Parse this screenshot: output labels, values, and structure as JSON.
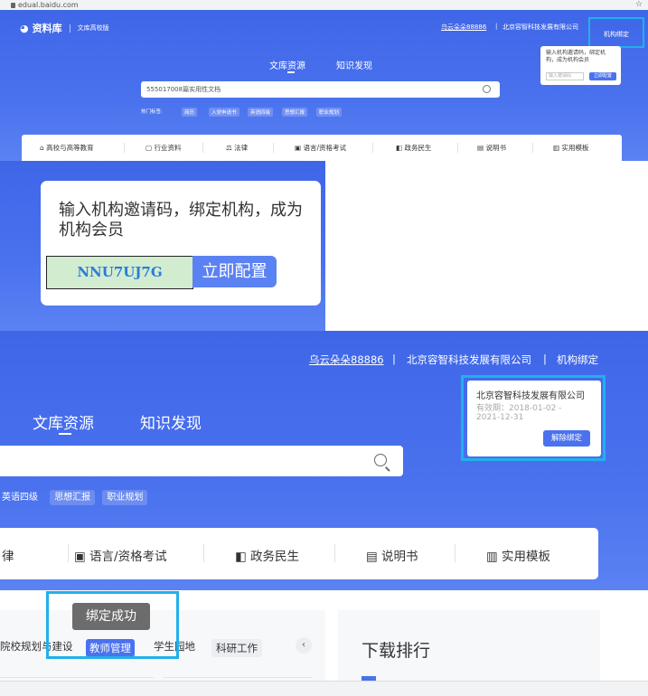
{
  "browser": {
    "url": "edual.baidu.com"
  },
  "s1": {
    "logo": "资料库",
    "logo_sub": "文库高校版",
    "user": "乌云朵朵88886",
    "org": "北京容智科技发展有限公司",
    "bind": "机构绑定",
    "popup_text": "输入机构邀请码，绑定机构，成为机构会员",
    "popup_input": "输入邀请码",
    "popup_btn": "立即配置",
    "tabs": [
      "文库资源",
      "知识发现"
    ],
    "search": "555017008篇实用性文档",
    "hot_label": "热门标签:",
    "hot": [
      "简历",
      "入党申请书",
      "英语四级",
      "思想汇报",
      "职业规划"
    ],
    "nav": [
      "高校与高等教育",
      "行业资料",
      "法律",
      "语言/资格考试",
      "政务民生",
      "说明书",
      "实用模板"
    ]
  },
  "s2": {
    "text": "输入机构邀请码，绑定机构，成为机构会员",
    "code": "NNU7UJ7G",
    "btn": "立即配置"
  },
  "s3": {
    "user": "乌云朵朵88886",
    "org": "北京容智科技发展有限公司",
    "bind": "机构绑定",
    "popup_org": "北京容智科技发展有限公司",
    "popup_date": "有效期：2018-01-02 - 2021-12-31",
    "popup_btn": "解除绑定",
    "tabs": [
      "文库资源",
      "知识发现"
    ],
    "hot": [
      "英语四级",
      "思想汇报",
      "职业规划"
    ],
    "nav": [
      "律",
      "语言/资格考试",
      "政务民生",
      "说明书",
      "实用模板"
    ]
  },
  "s4": {
    "toast": "绑定成功",
    "row": [
      "院校规划与建设",
      "教师管理",
      "学生园地",
      "科研工作"
    ],
    "arrow": "‹",
    "rank": "下载排行"
  },
  "colors": {
    "accent": "#4a72ee",
    "highlight": "#21b0ea",
    "code_bg": "#d2ecd0",
    "code_text": "#2a7dd8"
  }
}
